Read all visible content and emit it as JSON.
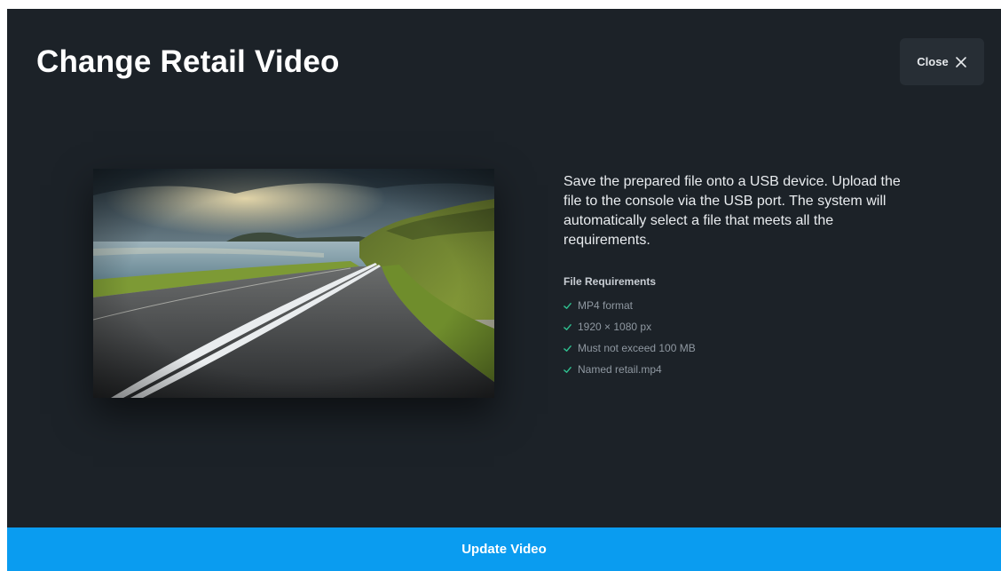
{
  "dialog": {
    "title": "Change Retail Video",
    "close_label": "Close",
    "close_icon": "close-icon"
  },
  "preview": {
    "icon": "video-preview-image"
  },
  "info": {
    "description": "Save the prepared file onto a USB device. Upload the file to the console via the USB port. The system will automatically select a file that meets all the requirements.",
    "requirements_title": "File Requirements",
    "requirements": [
      "MP4 format",
      "1920 × 1080 px",
      "Must not exceed 100 MB",
      "Named retail.mp4"
    ],
    "check_icon": "check-icon"
  },
  "footer": {
    "update_label": "Update Video"
  },
  "colors": {
    "background": "#1c2228",
    "accent": "#0a9cf0",
    "check": "#2fbf8f"
  }
}
